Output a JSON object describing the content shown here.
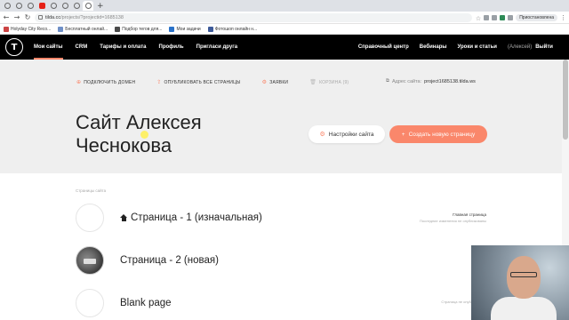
{
  "browser": {
    "url_host": "tilda.cc",
    "url_path": "/projects/?projectid=1685138",
    "paused_label": "Приостановлена",
    "nav": {
      "back": "←",
      "forward": "→",
      "reload": "↻"
    }
  },
  "bookmarks": [
    {
      "label": "Holyday City Reco..."
    },
    {
      "label": "Подбор тегов для..."
    },
    {
      "label": "Мои задачи"
    },
    {
      "label": "Фотошоп онлайн н..."
    }
  ],
  "bookmark_leading": "Бесплатный онлай...",
  "tilda_nav": {
    "logo": "T",
    "items": [
      "Мои сайты",
      "CRM",
      "Тарифы и оплата",
      "Профиль",
      "Пригласи друга"
    ],
    "right_items": [
      "Справочный центр",
      "Вебинары",
      "Уроки и статьи"
    ],
    "user": "(Алексей)",
    "logout": "Выйти"
  },
  "project": {
    "actions": [
      {
        "label": "ПОДКЛЮЧИТЬ ДОМЕН",
        "icon": "⊕"
      },
      {
        "label": "ОПУБЛИКОВАТЬ ВСЕ СТРАНИЦЫ",
        "icon": "⇪"
      },
      {
        "label": "ЗАЯВКИ",
        "icon": "⚙"
      },
      {
        "label": "КОРЗИНА (9)",
        "icon": "🗑"
      }
    ],
    "address_label": "Адрес сайта:",
    "address_value": "project1685138.tilda.ws",
    "title_line1": "Сайт Алексея",
    "title_line2": "Чеснокова",
    "settings_button": "Настройки сайта",
    "settings_icon": "⚙",
    "create_button": "Создать новую страницу",
    "create_icon": "+"
  },
  "pages": {
    "section_label": "Страницы сайта",
    "items": [
      {
        "title": "Страница - 1 (изначальная)",
        "meta_top": "Главная страница",
        "meta_bottom": "Последние изменения не опубликованы"
      },
      {
        "title": "Страница - 2 (новая)",
        "meta_top": "",
        "meta_bottom": ""
      },
      {
        "title": "Blank page",
        "meta_top": "Страница не опубликована",
        "meta_bottom": ""
      }
    ]
  },
  "colors": {
    "accent": "#fa876b",
    "nav_bg": "#000000",
    "header_bg": "#efefef"
  }
}
